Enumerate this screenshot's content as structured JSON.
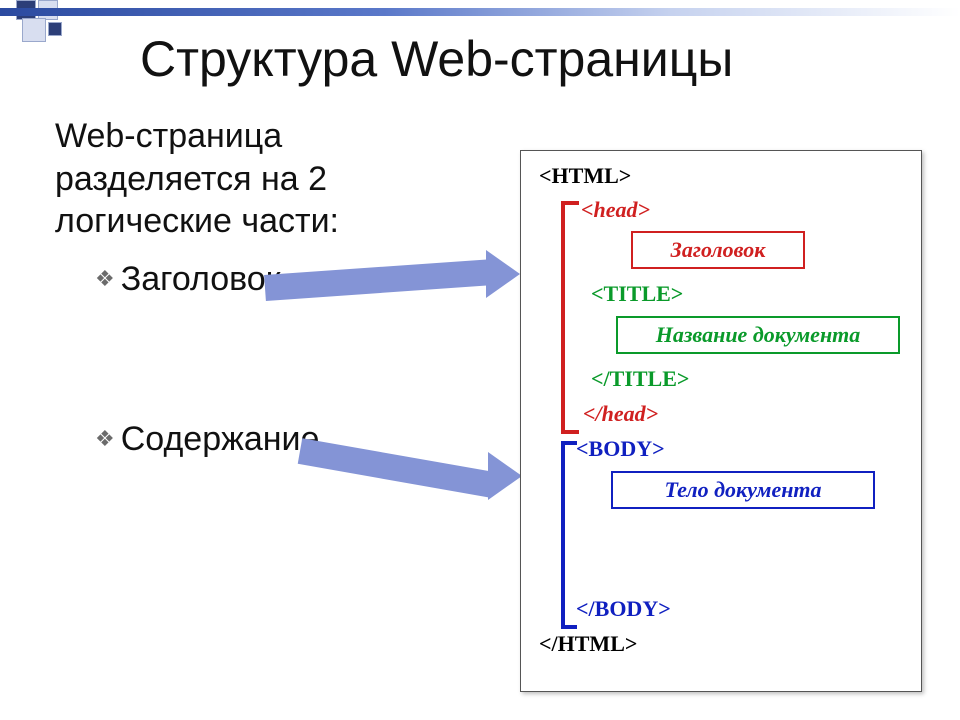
{
  "title": "Структура Web-страницы",
  "paragraph": "Web-страница разделяется на 2 логические части:",
  "bullets": {
    "header": "Заголовок",
    "content": "Содержание"
  },
  "diagram": {
    "tags": {
      "html_open": "<HTML>",
      "head_open": "<head>",
      "title_open": "<TITLE>",
      "title_close": "</TITLE>",
      "head_close": "</head>",
      "body_open": "<BODY>",
      "body_close": "</BODY>",
      "html_close": "</HTML>"
    },
    "labels": {
      "header_box": "Заголовок",
      "doc_title_box": "Название документа",
      "body_box": "Тело документа"
    }
  }
}
